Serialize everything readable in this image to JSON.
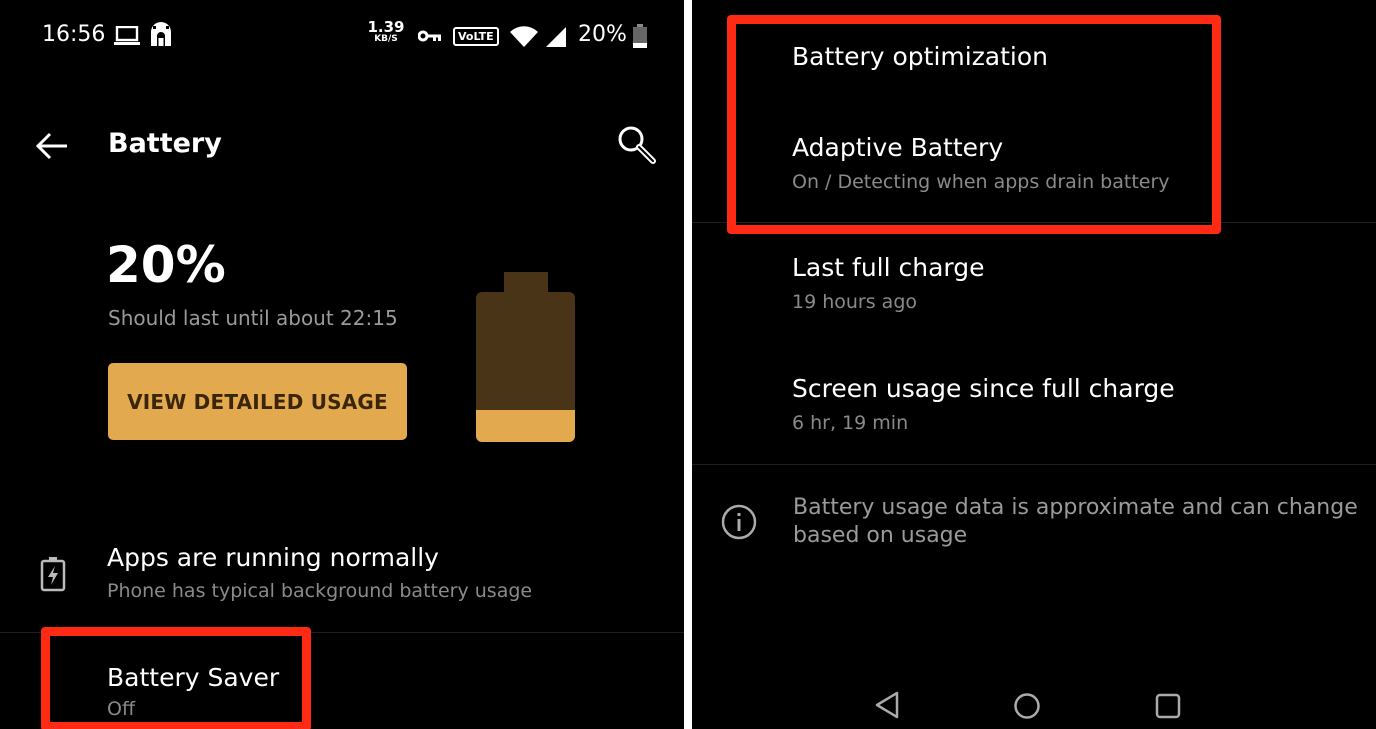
{
  "status_bar": {
    "time": "16:56",
    "speed_value": "1.39",
    "speed_unit": "KB/S",
    "volte_label": "VoLTE",
    "battery_percent": "20%"
  },
  "header": {
    "title": "Battery"
  },
  "battery": {
    "level_percent": "20%",
    "estimate": "Should last until about 22:15",
    "view_usage_button": "VIEW DETAILED USAGE",
    "level_fraction": 0.2
  },
  "status_row": {
    "title": "Apps are running normally",
    "subtitle": "Phone has typical background battery usage"
  },
  "battery_saver": {
    "title": "Battery Saver",
    "value": "Off"
  },
  "right_list": {
    "battery_optimization": {
      "title": "Battery optimization"
    },
    "adaptive_battery": {
      "title": "Adaptive Battery",
      "subtitle": "On / Detecting when apps drain battery"
    },
    "last_full_charge": {
      "title": "Last full charge",
      "value": "19 hours ago"
    },
    "screen_usage": {
      "title": "Screen usage since full charge",
      "value": "6 hr, 19 min"
    },
    "info_note": {
      "line1": "Battery usage data is approximate and can change",
      "line2": "based on usage"
    }
  },
  "colors": {
    "accent": "#e3a94f",
    "battery_body": "#4a3418",
    "highlight": "#ff2a14",
    "background": "#000000"
  },
  "icons": {
    "back": "arrow-left-icon",
    "search": "search-icon",
    "battery_status": "battery-charging-icon",
    "info": "info-icon",
    "nav_back": "triangle-back-icon",
    "nav_home": "circle-home-icon",
    "nav_recents": "square-recents-icon"
  }
}
